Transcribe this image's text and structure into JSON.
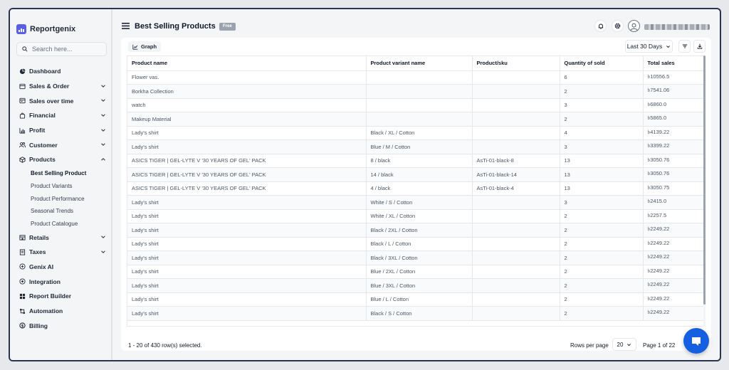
{
  "app": {
    "brand": "Reportgenix"
  },
  "sidebar": {
    "search_placeholder": "Search here...",
    "items": [
      {
        "label": "Dashboard",
        "icon": "pie-chart-icon",
        "expandable": false
      },
      {
        "label": "Sales & Order",
        "icon": "store-icon",
        "expandable": true
      },
      {
        "label": "Sales over time",
        "icon": "calendar-icon",
        "expandable": true
      },
      {
        "label": "Financial",
        "icon": "bag-icon",
        "expandable": true
      },
      {
        "label": "Profit",
        "icon": "bar-chart-icon",
        "expandable": true
      },
      {
        "label": "Customer",
        "icon": "users-icon",
        "expandable": true
      },
      {
        "label": "Products",
        "icon": "box-icon",
        "expandable": true,
        "expanded": true
      }
    ],
    "products_sub": [
      {
        "label": "Best Selling Product",
        "active": true
      },
      {
        "label": "Product Variants"
      },
      {
        "label": "Product Performance"
      },
      {
        "label": "Seasonal Trends"
      },
      {
        "label": "Product Catalogue"
      }
    ],
    "items_after": [
      {
        "label": "Retails",
        "icon": "retail-icon",
        "expandable": true
      },
      {
        "label": "Taxes",
        "icon": "receipt-icon",
        "expandable": true
      },
      {
        "label": "Genix AI",
        "icon": "sparkle-icon",
        "expandable": false
      },
      {
        "label": "Integration",
        "icon": "puzzle-icon",
        "expandable": false
      },
      {
        "label": "Report Builder",
        "icon": "grid-icon",
        "expandable": false
      },
      {
        "label": "Automation",
        "icon": "automation-icon",
        "expandable": false
      },
      {
        "label": "Billing",
        "icon": "dollar-icon",
        "expandable": false
      }
    ]
  },
  "header": {
    "title": "Best Selling Products",
    "badge": "Free"
  },
  "toolbar": {
    "graph_label": "Graph",
    "date_range": "Last 30 Days"
  },
  "table": {
    "columns": [
      "Product name",
      "Product variant name",
      "Product/sku",
      "Quantity of sold",
      "Total sales"
    ],
    "rows": [
      [
        "Flower vas.",
        "",
        "",
        "6",
        "৳10556.5"
      ],
      [
        "Borkha Collection",
        "",
        "",
        "2",
        "৳7541.06"
      ],
      [
        "watch",
        "",
        "",
        "3",
        "৳6860.0"
      ],
      [
        "Makeup Material",
        "",
        "",
        "2",
        "৳5865.0"
      ],
      [
        "Lady's shirt",
        "Black / XL / Cotton",
        "",
        "4",
        "৳4139.22"
      ],
      [
        "Lady's shirt",
        "Blue / M / Cotton",
        "",
        "3",
        "৳3399.22"
      ],
      [
        "ASICS TIGER | GEL-LYTE V '30 YEARS OF GEL' PACK",
        "8 / black",
        "AsTi-01-black-8",
        "13",
        "৳3050.76"
      ],
      [
        "ASICS TIGER | GEL-LYTE V '30 YEARS OF GEL' PACK",
        "14 / black",
        "AsTi-01-black-14",
        "13",
        "৳3050.76"
      ],
      [
        "ASICS TIGER | GEL-LYTE V '30 YEARS OF GEL' PACK",
        "4 / black",
        "AsTi-01-black-4",
        "13",
        "৳3050.75"
      ],
      [
        "Lady's shirt",
        "White / S / Cotton",
        "",
        "3",
        "৳2415.0"
      ],
      [
        "Lady's shirt",
        "White / XL / Cotton",
        "",
        "2",
        "৳2257.5"
      ],
      [
        "Lady's shirt",
        "Black / 2XL / Cotton",
        "",
        "2",
        "৳2249.22"
      ],
      [
        "Lady's shirt",
        "Black / L / Cotton",
        "",
        "2",
        "৳2249.22"
      ],
      [
        "Lady's shirt",
        "Black / 3XL / Cotton",
        "",
        "2",
        "৳2249.22"
      ],
      [
        "Lady's shirt",
        "Blue / 2XL / Cotton",
        "",
        "2",
        "৳2249.22"
      ],
      [
        "Lady's shirt",
        "Blue / 3XL / Cotton",
        "",
        "2",
        "৳2249.22"
      ],
      [
        "Lady's shirt",
        "Blue / L / Cotton",
        "",
        "2",
        "৳2249.22"
      ],
      [
        "Lady's shirt",
        "Black / S / Cotton",
        "",
        "2",
        "৳2249.22"
      ]
    ]
  },
  "footer": {
    "selection": "1 - 20 of 430 row(s) selected.",
    "rows_per_page_label": "Rows per page",
    "rows_per_page": "20",
    "page_info": "Page 1 of 22"
  },
  "colors": {
    "accent": "#5b5fe6",
    "chat_fab": "#1560e0",
    "frame_border": "#2a3350"
  }
}
